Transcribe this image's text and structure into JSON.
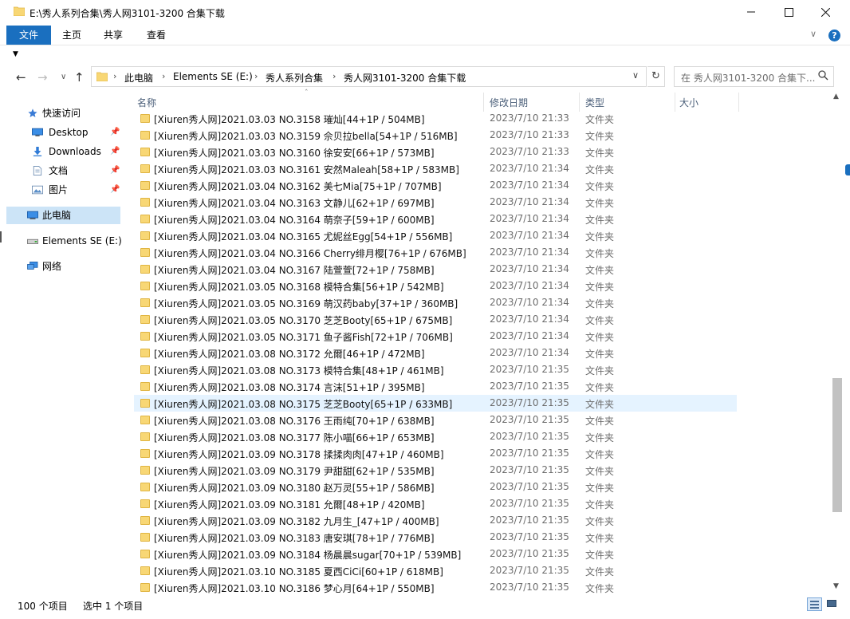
{
  "window": {
    "title": "E:\\秀人系列合集\\秀人网3101-3200 合集下载"
  },
  "ribbon": {
    "tabs": [
      {
        "label": "文件"
      },
      {
        "label": "主页"
      },
      {
        "label": "共享"
      },
      {
        "label": "查看"
      }
    ],
    "accent": "#1a6fbf"
  },
  "address": {
    "crumbs": [
      "此电脑",
      "Elements SE (E:)",
      "秀人系列合集",
      "秀人网3101-3200 合集下载"
    ]
  },
  "search": {
    "placeholder": "在 秀人网3101-3200 合集下..."
  },
  "navpane": {
    "items": [
      {
        "label": "快速访问",
        "icon": "star-icon"
      },
      {
        "label": "Desktop",
        "icon": "desktop-icon",
        "pinned": true
      },
      {
        "label": "Downloads",
        "icon": "download-icon",
        "pinned": true
      },
      {
        "label": "文档",
        "icon": "document-icon",
        "pinned": true
      },
      {
        "label": "图片",
        "icon": "picture-icon",
        "pinned": true
      },
      {
        "label": "此电脑",
        "icon": "computer-icon",
        "selected": true
      },
      {
        "label": "Elements SE (E:)",
        "icon": "drive-icon"
      },
      {
        "label": "网络",
        "icon": "network-icon"
      }
    ]
  },
  "columns": {
    "name": "名称",
    "date": "修改日期",
    "type": "类型",
    "size": "大小"
  },
  "files": [
    {
      "name": "[Xiuren秀人网]2021.03.03 NO.3158 璀灿[44+1P / 504MB]",
      "date": "2023/7/10 21:33",
      "type": "文件夹"
    },
    {
      "name": "[Xiuren秀人网]2021.03.03 NO.3159 佘贝拉bella[54+1P / 516MB]",
      "date": "2023/7/10 21:33",
      "type": "文件夹"
    },
    {
      "name": "[Xiuren秀人网]2021.03.03 NO.3160 徐安安[66+1P / 573MB]",
      "date": "2023/7/10 21:33",
      "type": "文件夹"
    },
    {
      "name": "[Xiuren秀人网]2021.03.03 NO.3161 安然Maleah[58+1P / 583MB]",
      "date": "2023/7/10 21:34",
      "type": "文件夹"
    },
    {
      "name": "[Xiuren秀人网]2021.03.04 NO.3162 美七Mia[75+1P / 707MB]",
      "date": "2023/7/10 21:34",
      "type": "文件夹"
    },
    {
      "name": "[Xiuren秀人网]2021.03.04 NO.3163 文静儿[62+1P / 697MB]",
      "date": "2023/7/10 21:34",
      "type": "文件夹"
    },
    {
      "name": "[Xiuren秀人网]2021.03.04 NO.3164 萌奈子[59+1P / 600MB]",
      "date": "2023/7/10 21:34",
      "type": "文件夹"
    },
    {
      "name": "[Xiuren秀人网]2021.03.04 NO.3165 尤妮丝Egg[54+1P / 556MB]",
      "date": "2023/7/10 21:34",
      "type": "文件夹"
    },
    {
      "name": "[Xiuren秀人网]2021.03.04 NO.3166 Cherry绯月樱[76+1P / 676MB]",
      "date": "2023/7/10 21:34",
      "type": "文件夹"
    },
    {
      "name": "[Xiuren秀人网]2021.03.04 NO.3167 陆萱萱[72+1P / 758MB]",
      "date": "2023/7/10 21:34",
      "type": "文件夹"
    },
    {
      "name": "[Xiuren秀人网]2021.03.05 NO.3168 模特合集[56+1P / 542MB]",
      "date": "2023/7/10 21:34",
      "type": "文件夹"
    },
    {
      "name": "[Xiuren秀人网]2021.03.05 NO.3169 萌汉药baby[37+1P / 360MB]",
      "date": "2023/7/10 21:34",
      "type": "文件夹"
    },
    {
      "name": "[Xiuren秀人网]2021.03.05 NO.3170 芝芝Booty[65+1P / 675MB]",
      "date": "2023/7/10 21:34",
      "type": "文件夹"
    },
    {
      "name": "[Xiuren秀人网]2021.03.05 NO.3171 鱼子酱Fish[72+1P / 706MB]",
      "date": "2023/7/10 21:34",
      "type": "文件夹"
    },
    {
      "name": "[Xiuren秀人网]2021.03.08 NO.3172 允爾[46+1P / 472MB]",
      "date": "2023/7/10 21:34",
      "type": "文件夹"
    },
    {
      "name": "[Xiuren秀人网]2021.03.08 NO.3173 模特合集[48+1P / 461MB]",
      "date": "2023/7/10 21:35",
      "type": "文件夹"
    },
    {
      "name": "[Xiuren秀人网]2021.03.08 NO.3174 言沫[51+1P / 395MB]",
      "date": "2023/7/10 21:35",
      "type": "文件夹"
    },
    {
      "name": "[Xiuren秀人网]2021.03.08 NO.3175 芝芝Booty[65+1P / 633MB]",
      "date": "2023/7/10 21:35",
      "type": "文件夹",
      "selected": true
    },
    {
      "name": "[Xiuren秀人网]2021.03.08 NO.3176 王雨纯[70+1P / 638MB]",
      "date": "2023/7/10 21:35",
      "type": "文件夹"
    },
    {
      "name": "[Xiuren秀人网]2021.03.08 NO.3177 陈小喵[66+1P / 653MB]",
      "date": "2023/7/10 21:35",
      "type": "文件夹"
    },
    {
      "name": "[Xiuren秀人网]2021.03.09 NO.3178 揉揉肉肉[47+1P / 460MB]",
      "date": "2023/7/10 21:35",
      "type": "文件夹"
    },
    {
      "name": "[Xiuren秀人网]2021.03.09 NO.3179 尹甜甜[62+1P / 535MB]",
      "date": "2023/7/10 21:35",
      "type": "文件夹"
    },
    {
      "name": "[Xiuren秀人网]2021.03.09 NO.3180 赵万灵[55+1P / 586MB]",
      "date": "2023/7/10 21:35",
      "type": "文件夹"
    },
    {
      "name": "[Xiuren秀人网]2021.03.09 NO.3181 允爾[48+1P / 420MB]",
      "date": "2023/7/10 21:35",
      "type": "文件夹"
    },
    {
      "name": "[Xiuren秀人网]2021.03.09 NO.3182 九月生_[47+1P / 400MB]",
      "date": "2023/7/10 21:35",
      "type": "文件夹"
    },
    {
      "name": "[Xiuren秀人网]2021.03.09 NO.3183 唐安琪[78+1P / 776MB]",
      "date": "2023/7/10 21:35",
      "type": "文件夹"
    },
    {
      "name": "[Xiuren秀人网]2021.03.09 NO.3184 杨晨晨sugar[70+1P / 539MB]",
      "date": "2023/7/10 21:35",
      "type": "文件夹"
    },
    {
      "name": "[Xiuren秀人网]2021.03.10 NO.3185 夏西CiCi[60+1P / 618MB]",
      "date": "2023/7/10 21:35",
      "type": "文件夹"
    },
    {
      "name": "[Xiuren秀人网]2021.03.10 NO.3186 梦心月[64+1P / 550MB]",
      "date": "2023/7/10 21:35",
      "type": "文件夹"
    }
  ],
  "status": {
    "count": "100 个项目",
    "selected": "选中 1 个项目"
  }
}
